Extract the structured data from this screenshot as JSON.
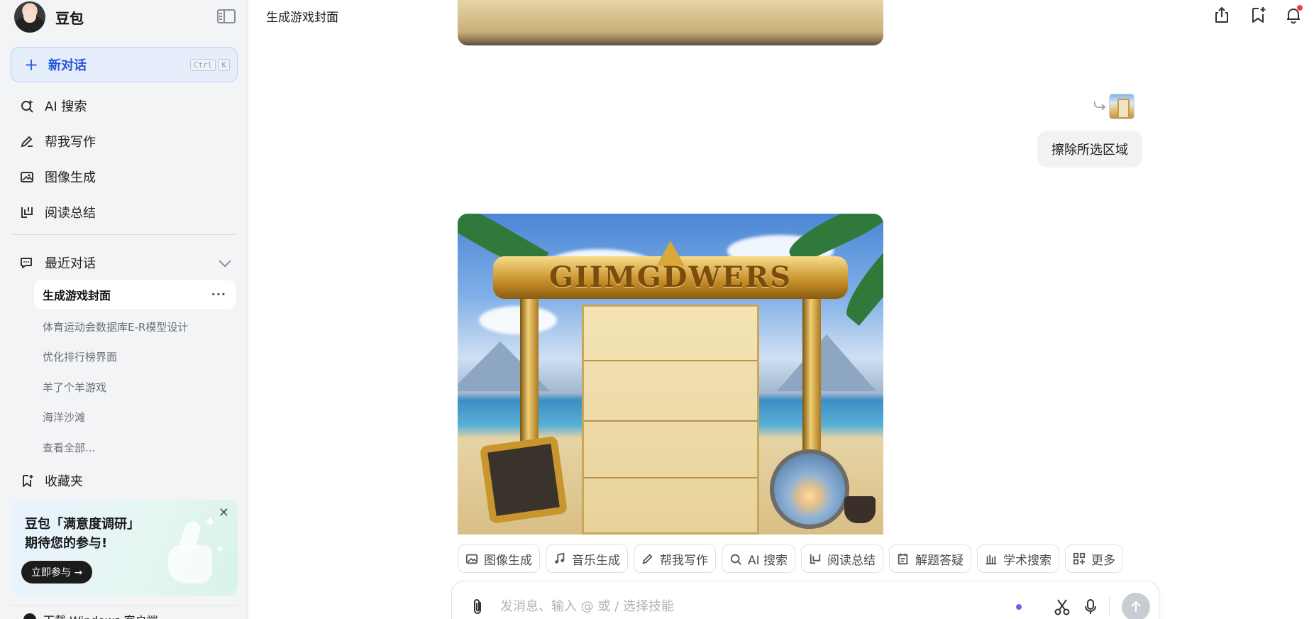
{
  "sidebar": {
    "brand": "豆包",
    "new_chat": {
      "label": "新对话",
      "shortcut": [
        "Ctrl",
        "K"
      ]
    },
    "nav": [
      {
        "label": "AI 搜索",
        "icon": "search-sparkle-icon"
      },
      {
        "label": "帮我写作",
        "icon": "pen-icon"
      },
      {
        "label": "图像生成",
        "icon": "image-icon"
      },
      {
        "label": "阅读总结",
        "icon": "book-icon"
      }
    ],
    "recent": {
      "title": "最近对话",
      "items": [
        {
          "label": "生成游戏封面",
          "active": true
        },
        {
          "label": "体育运动会数据库E-R模型设计"
        },
        {
          "label": "优化排行榜界面"
        },
        {
          "label": "羊了个羊游戏"
        },
        {
          "label": "海洋沙滩"
        },
        {
          "label": "查看全部..."
        }
      ]
    },
    "favorites": "收藏夹",
    "promo": {
      "line1": "豆包「满意度调研」",
      "line2": "期待您的参与!",
      "button": "立即参与 →"
    },
    "download": "下载 Windows 客户端"
  },
  "header": {
    "title": "生成游戏封面",
    "icons": [
      "share-icon",
      "bookmark-icon",
      "bell-icon"
    ]
  },
  "conversation": {
    "user_message": "擦除所选区域",
    "image_banner_text": "GIIMGDWERS"
  },
  "skills": [
    {
      "label": "图像生成",
      "icon": "image-icon"
    },
    {
      "label": "音乐生成",
      "icon": "music-icon"
    },
    {
      "label": "帮我写作",
      "icon": "pen-icon"
    },
    {
      "label": "AI 搜索",
      "icon": "search-sparkle-icon"
    },
    {
      "label": "阅读总结",
      "icon": "book-icon"
    },
    {
      "label": "解题答疑",
      "icon": "question-icon"
    },
    {
      "label": "学术搜索",
      "icon": "library-icon"
    },
    {
      "label": "更多",
      "icon": "grid-icon"
    }
  ],
  "input": {
    "placeholder": "发消息、输入 @ 或 / 选择技能"
  },
  "colors": {
    "accent": "#2456d9",
    "sidebar_bg": "#f3f4f6",
    "notification_dot": "#f03e3e"
  }
}
